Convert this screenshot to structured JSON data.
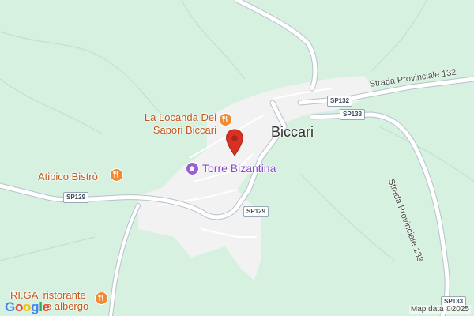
{
  "map": {
    "town_label": "Biccari",
    "pois": [
      {
        "line1": "La Locanda Dei",
        "line2": "Sapori Biccari",
        "icon": "restaurant-icon"
      },
      {
        "line1": "Atipico Bistrò",
        "icon": "restaurant-icon"
      },
      {
        "line1": "Torre Bizantina",
        "icon": "castle-icon"
      },
      {
        "line1": "RI.GA' ristorante",
        "line2": "e albergo",
        "icon": "restaurant-icon"
      }
    ],
    "road_names": [
      "Strada Provinciale 132",
      "Strada Provinciale 133"
    ],
    "shields": [
      "SP132",
      "SP133",
      "SP129",
      "SP129",
      "SP133"
    ],
    "pin": {
      "icon": "location-pin-icon",
      "color": "#d93025"
    },
    "branding": "Google",
    "attribution": "Map data ©2025",
    "colors": {
      "land": "#d6f1df",
      "urban": "#f2f2f2",
      "road": "#ffffff",
      "road_casing": "#b6c2cc",
      "restaurant": "#f08b33",
      "landmark": "#9a5fd0"
    }
  }
}
